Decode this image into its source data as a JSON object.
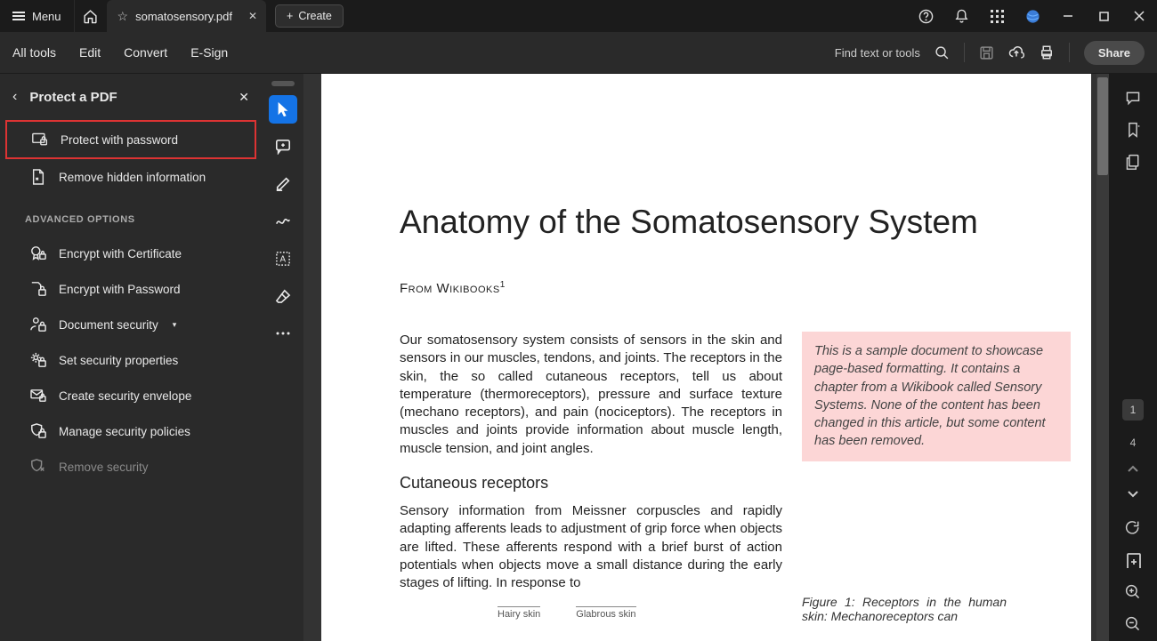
{
  "titlebar": {
    "menu": "Menu",
    "tab_name": "somatosensory.pdf",
    "create": "Create"
  },
  "toolbar": {
    "all_tools": "All tools",
    "edit": "Edit",
    "convert": "Convert",
    "esign": "E-Sign",
    "hint": "Find text or tools",
    "share": "Share"
  },
  "left_panel": {
    "title": "Protect a PDF",
    "protect_password": "Protect with password",
    "remove_hidden": "Remove hidden information",
    "advanced": "ADVANCED OPTIONS",
    "encrypt_cert": "Encrypt with Certificate",
    "encrypt_pw": "Encrypt with Password",
    "doc_security": "Document security",
    "set_props": "Set security properties",
    "envelope": "Create security envelope",
    "policies": "Manage security policies",
    "remove_security": "Remove security"
  },
  "doc": {
    "title": "Anatomy of the Somatosensory System",
    "from": "From Wikibooks",
    "sup": "1",
    "para1": "Our somatosensory system consists of sensors in the skin and sensors in our muscles, tendons, and joints. The receptors in the skin, the so called cutaneous receptors, tell us about temperature (thermoreceptors), pressure and surface texture (mechano receptors), and pain (nociceptors). The receptors in muscles and joints provide information about muscle length, muscle tension, and joint angles.",
    "h3": "Cutaneous receptors",
    "para2": "Sensory information from Meissner corpuscles and rapidly adapting afferents leads to adjustment of grip force when objects are lifted. These afferents respond with a brief burst of action potentials when objects move a small distance during the early stages of lifting. In response to",
    "note": "This is a sample document to showcase page-based formatting. It contains a chapter from a Wikibook called Sensory Systems. None of the content has been changed in this article, but some content has been removed.",
    "hairy": "Hairy skin",
    "glabrous": "Glabrous skin",
    "fig": "Figure 1:  Receptors in the human skin: Mechanoreceptors can"
  },
  "nav": {
    "current": "1",
    "total": "4"
  }
}
